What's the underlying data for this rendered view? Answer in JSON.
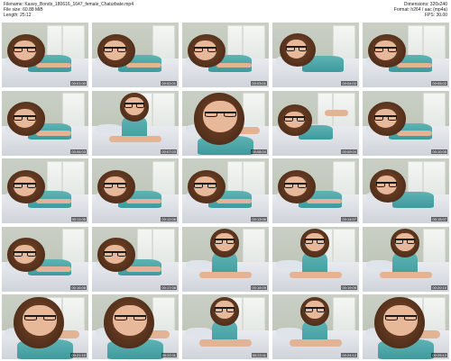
{
  "header": {
    "filename": "Filename: Kasey_Bonds_180616_1647_female_Chaturbate.mp4",
    "filesize": "File size: 60.88 MiB",
    "length": "Length: 25:12",
    "dimensions": "Dimensions: 320x240",
    "format": "Format: h264 / aac (mp4a)",
    "fps": "FPS: 30.00"
  },
  "colors": {
    "wall": "#c9cfc4",
    "bed": "#e9ebef",
    "hair": "#5a341e",
    "skin": "#e8b89a",
    "top": "#4fa8aa",
    "watermark": "#e85c92",
    "timestamp_bg": "#000000"
  },
  "thumbnails": [
    {
      "time": "00:01:00",
      "pose": "lying"
    },
    {
      "time": "00:02:01",
      "pose": "lying"
    },
    {
      "time": "00:03:01",
      "pose": "lying"
    },
    {
      "time": "00:04:02",
      "pose": "lying-hand"
    },
    {
      "time": "00:05:02",
      "pose": "lying"
    },
    {
      "time": "00:06:03",
      "pose": "lying"
    },
    {
      "time": "00:07:03",
      "pose": "sitting"
    },
    {
      "time": "00:08:04",
      "pose": "close"
    },
    {
      "time": "00:09:04",
      "pose": "lying-feet"
    },
    {
      "time": "00:10:05",
      "pose": "lying"
    },
    {
      "time": "00:11:05",
      "pose": "lying"
    },
    {
      "time": "00:12:06",
      "pose": "lying"
    },
    {
      "time": "00:13:06",
      "pose": "lying"
    },
    {
      "time": "00:14:07",
      "pose": "lying"
    },
    {
      "time": "00:15:07",
      "pose": "lying-hand"
    },
    {
      "time": "00:16:08",
      "pose": "lying"
    },
    {
      "time": "00:17:08",
      "pose": "lying"
    },
    {
      "time": "00:18:09",
      "pose": "sitting"
    },
    {
      "time": "00:19:09",
      "pose": "sitting"
    },
    {
      "time": "00:20:10",
      "pose": "sitting"
    },
    {
      "time": "00:21:10",
      "pose": "close"
    },
    {
      "time": "00:22:11",
      "pose": "close"
    },
    {
      "time": "00:23:11",
      "pose": "sitting"
    },
    {
      "time": "00:24:12",
      "pose": "sitting"
    },
    {
      "time": "00:25:12",
      "pose": "close"
    }
  ]
}
